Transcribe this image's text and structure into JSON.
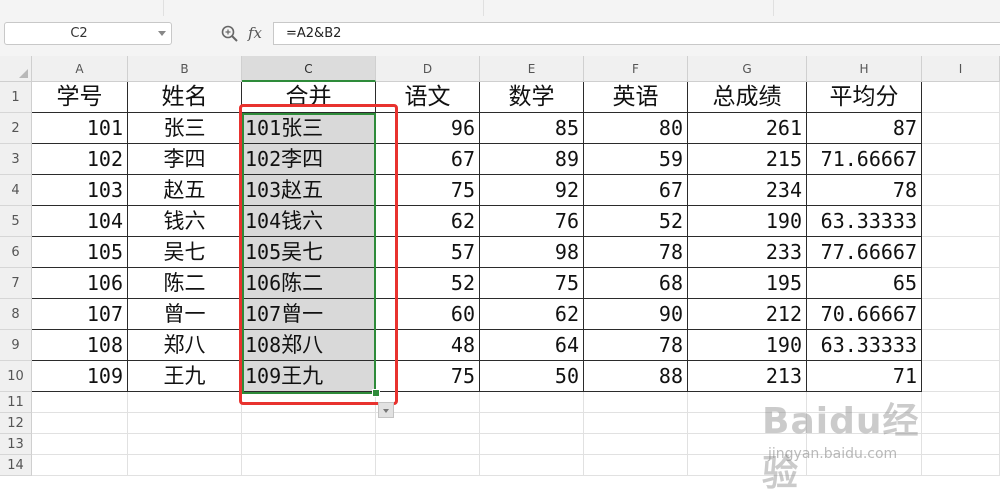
{
  "formula_bar": {
    "name_box": "C2",
    "fx_label": "fx",
    "formula": "=A2&B2"
  },
  "columns": [
    "A",
    "B",
    "C",
    "D",
    "E",
    "F",
    "G",
    "H",
    "I"
  ],
  "selected_column": "C",
  "rows": [
    "1",
    "2",
    "3",
    "4",
    "5",
    "6",
    "7",
    "8",
    "9",
    "10",
    "11",
    "12",
    "13",
    "14"
  ],
  "headers": [
    "学号",
    "姓名",
    "合并",
    "语文",
    "数学",
    "英语",
    "总成绩",
    "平均分"
  ],
  "table": [
    {
      "id": "101",
      "name": "张三",
      "merge_num": "101",
      "merge_name": "张三",
      "chinese": "96",
      "math": "85",
      "english": "80",
      "total": "261",
      "avg": "87"
    },
    {
      "id": "102",
      "name": "李四",
      "merge_num": "102",
      "merge_name": "李四",
      "chinese": "67",
      "math": "89",
      "english": "59",
      "total": "215",
      "avg": "71.66667"
    },
    {
      "id": "103",
      "name": "赵五",
      "merge_num": "103",
      "merge_name": "赵五",
      "chinese": "75",
      "math": "92",
      "english": "67",
      "total": "234",
      "avg": "78"
    },
    {
      "id": "104",
      "name": "钱六",
      "merge_num": "104",
      "merge_name": "钱六",
      "chinese": "62",
      "math": "76",
      "english": "52",
      "total": "190",
      "avg": "63.33333"
    },
    {
      "id": "105",
      "name": "吴七",
      "merge_num": "105",
      "merge_name": "吴七",
      "chinese": "57",
      "math": "98",
      "english": "78",
      "total": "233",
      "avg": "77.66667"
    },
    {
      "id": "106",
      "name": "陈二",
      "merge_num": "106",
      "merge_name": "陈二",
      "chinese": "52",
      "math": "75",
      "english": "68",
      "total": "195",
      "avg": "65"
    },
    {
      "id": "107",
      "name": "曾一",
      "merge_num": "107",
      "merge_name": "曾一",
      "chinese": "60",
      "math": "62",
      "english": "90",
      "total": "212",
      "avg": "70.66667"
    },
    {
      "id": "108",
      "name": "郑八",
      "merge_num": "108",
      "merge_name": "郑八",
      "chinese": "48",
      "math": "64",
      "english": "78",
      "total": "190",
      "avg": "63.33333"
    },
    {
      "id": "109",
      "name": "王九",
      "merge_num": "109",
      "merge_name": "王九",
      "chinese": "75",
      "math": "50",
      "english": "88",
      "total": "213",
      "avg": "71"
    }
  ],
  "watermark": {
    "brand": "Baidu经验",
    "url": "jingyan.baidu.com"
  },
  "colors": {
    "selection": "#2e8b3a",
    "highlight_box": "#e8322e",
    "selected_fill": "#d9d9d9"
  }
}
